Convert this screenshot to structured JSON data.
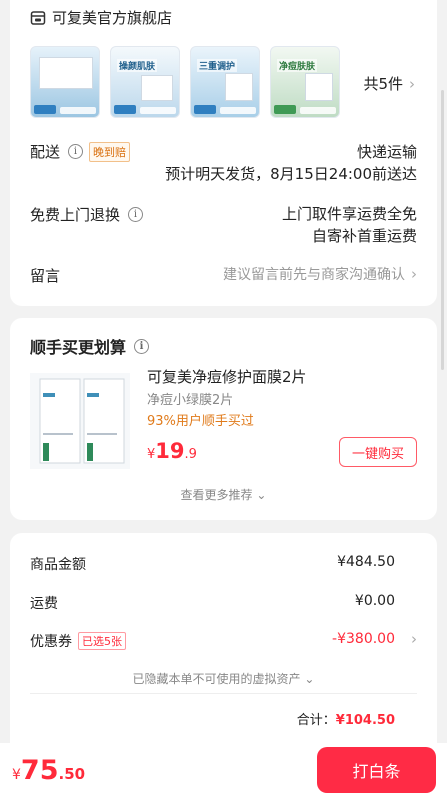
{
  "store": {
    "name": "可复美官方旗舰店",
    "thumbs": [
      {
        "title": "",
        "bg": "#d9ecf7"
      },
      {
        "title": "操颜肌肤",
        "bg": "#e8f2f8"
      },
      {
        "title": "三重调护",
        "bg": "#e3f0f8"
      },
      {
        "title": "净痘肤肤",
        "bg": "#e9f4ea"
      }
    ],
    "count": "共5件"
  },
  "delivery": {
    "label": "配送",
    "badge": "晚到赔",
    "method": "快递运输",
    "eta": "预计明天发货，8月15日24:00前送达"
  },
  "returns": {
    "label": "免费上门退换",
    "line1": "上门取件享运费全免",
    "line2": "自寄补首重运费"
  },
  "note": {
    "label": "留言",
    "placeholder": "建议留言前先与商家沟通确认"
  },
  "addon": {
    "title": "顺手买更划算",
    "product_name": "可复美净痘修护面膜2片",
    "subtitle": "净痘小绿膜2片",
    "stat": "93%用户顺手买过",
    "price_currency": "¥",
    "price_int": "19",
    "price_dec": ".9",
    "buy_label": "一键购买",
    "more_label": "查看更多推荐"
  },
  "pricing": {
    "goods_label": "商品金额",
    "goods_value": "¥484.50",
    "shipping_label": "运费",
    "shipping_value": "¥0.00",
    "coupon_label": "优惠券",
    "coupon_badge": "已选5张",
    "coupon_value": "-¥380.00",
    "hidden_note": "已隐藏本单不可使用的虚拟资产",
    "total_label": "合计：",
    "total_value": "¥104.50"
  },
  "footer": {
    "currency": "¥",
    "price_int": "75",
    "price_dec": ".50",
    "pay_label": "打白条"
  },
  "colors": {
    "accent_red": "#ff2b45",
    "orange": "#e07a1a"
  }
}
